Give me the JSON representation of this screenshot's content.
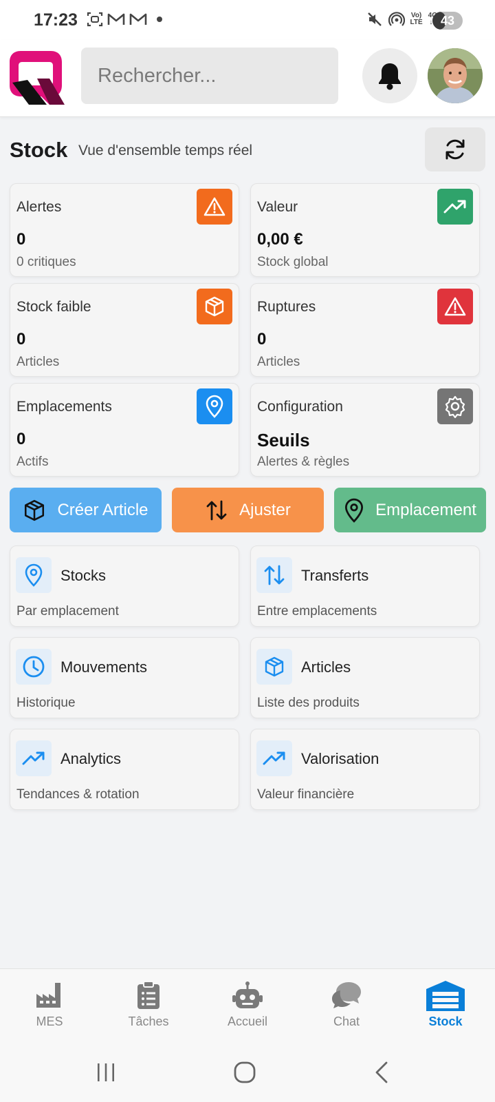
{
  "status_bar": {
    "time": "17:23",
    "signal_label_top": "Vo)",
    "signal_label_bottom": "LTE",
    "network": "4G",
    "battery": "43",
    "battery_level": 0.43
  },
  "header": {
    "search_placeholder": "Rechercher...",
    "logo_letter": "Q"
  },
  "page": {
    "title": "Stock",
    "subtitle": "Vue d'ensemble temps réel"
  },
  "stats": [
    {
      "label": "Alertes",
      "value": "0",
      "sub": "0 critiques",
      "icon": "warning-icon",
      "color": "#f26b1d"
    },
    {
      "label": "Valeur",
      "value": "0,00 €",
      "sub": "Stock global",
      "icon": "trending-up-icon",
      "color": "#2fa36b"
    },
    {
      "label": "Stock faible",
      "value": "0",
      "sub": "Articles",
      "icon": "box-icon",
      "color": "#f26b1d"
    },
    {
      "label": "Ruptures",
      "value": "0",
      "sub": "Articles",
      "icon": "warning-icon",
      "color": "#e0343c"
    },
    {
      "label": "Emplacements",
      "value": "0",
      "sub": "Actifs",
      "icon": "location-pin-icon",
      "color": "#1b8ef0"
    },
    {
      "label": "Configuration",
      "value": "Seuils",
      "sub": "Alertes & règles",
      "icon": "gear-icon",
      "color": "#757575"
    }
  ],
  "actions": [
    {
      "label": "Créer Article",
      "icon": "box-icon",
      "color": "#5aaef0"
    },
    {
      "label": "Ajuster",
      "icon": "swap-arrows-icon",
      "color": "#f7924a"
    },
    {
      "label": "Emplacement",
      "icon": "location-pin-icon",
      "color": "#63bb8b"
    }
  ],
  "nav_cards": [
    {
      "title": "Stocks",
      "sub": "Par emplacement",
      "icon": "location-pin-icon"
    },
    {
      "title": "Transferts",
      "sub": "Entre emplacements",
      "icon": "swap-arrows-icon"
    },
    {
      "title": "Mouvements",
      "sub": "Historique",
      "icon": "clock-icon"
    },
    {
      "title": "Articles",
      "sub": "Liste des produits",
      "icon": "box-icon"
    },
    {
      "title": "Analytics",
      "sub": "Tendances & rotation",
      "icon": "trending-up-icon"
    },
    {
      "title": "Valorisation",
      "sub": "Valeur financière",
      "icon": "trending-up-icon"
    }
  ],
  "tabs": [
    {
      "label": "MES",
      "icon": "factory-icon",
      "active": false
    },
    {
      "label": "Tâches",
      "icon": "clipboard-icon",
      "active": false
    },
    {
      "label": "Accueil",
      "icon": "robot-icon",
      "active": false
    },
    {
      "label": "Chat",
      "icon": "chat-bubbles-icon",
      "active": false
    },
    {
      "label": "Stock",
      "icon": "warehouse-icon",
      "active": true
    }
  ],
  "colors": {
    "accent": "#0a7fd8",
    "icon_blue": "#1b8ef0"
  }
}
